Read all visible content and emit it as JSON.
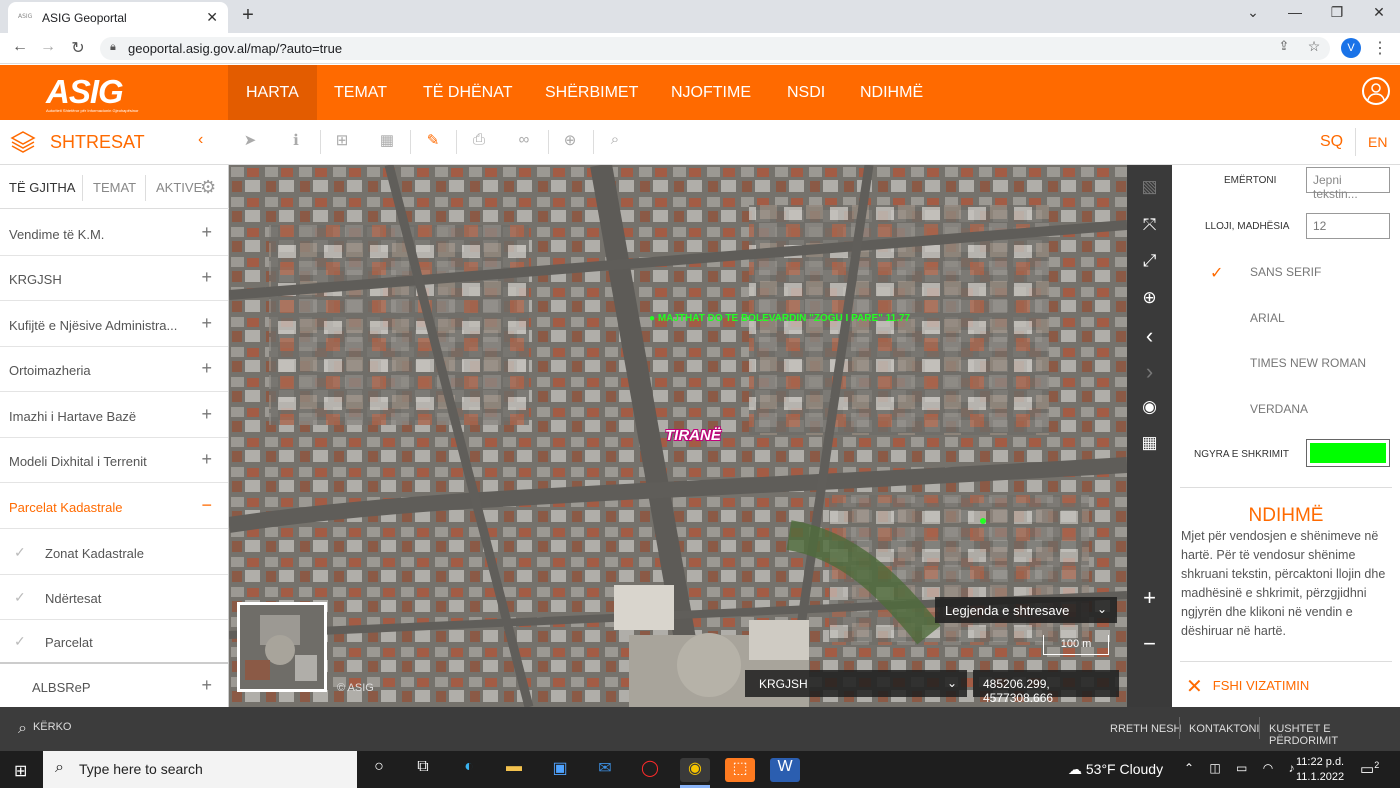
{
  "browser": {
    "tab_title": "ASIG Geoportal",
    "favicon_text": "ASIG",
    "url": "geoportal.asig.gov.al/map/?auto=true",
    "profile_initial": "V"
  },
  "header": {
    "logo_text": "ASIG",
    "logo_subtext": "Autoriteti Shtetëror për Informacionin Gjeohapësinor",
    "menu": [
      {
        "label": "HARTA"
      },
      {
        "label": "TEMAT"
      },
      {
        "label": "TË DHËNAT"
      },
      {
        "label": "SHËRBIMET"
      },
      {
        "label": "NJOFTIME"
      },
      {
        "label": "NSDI"
      },
      {
        "label": "NDIHMË"
      }
    ]
  },
  "toolbar": {
    "panel_title": "SHTRESAT",
    "lang_sq": "SQ",
    "lang_en": "EN"
  },
  "layers": {
    "tabs": [
      "TË GJITHA",
      "TEMAT",
      "AKTIVE"
    ],
    "items": [
      {
        "label": "Vendime të K.M.",
        "state": "+"
      },
      {
        "label": "KRGJSH",
        "state": "+"
      },
      {
        "label": "Kufijtë e Njësive Administra...",
        "state": "+"
      },
      {
        "label": "Ortoimazheria",
        "state": "+"
      },
      {
        "label": "Imazhi i Hartave Bazë",
        "state": "+"
      },
      {
        "label": "Modeli Dixhital i Terrenit",
        "state": "+"
      },
      {
        "label": "Parcelat Kadastrale",
        "state": "−"
      }
    ],
    "subitems": [
      {
        "label": "Zonat Kadastrale"
      },
      {
        "label": "Ndërtesat"
      },
      {
        "label": "Parcelat"
      }
    ],
    "last_item": {
      "label": "ALBSReP",
      "state": "+"
    }
  },
  "map": {
    "annotation": "● MAJTHAT DO TE BOLEVARDIN \"ZOGU I PARE\" 11.77",
    "city_label": "TIRANË",
    "copyright": "© ASIG",
    "legend_label": "Legjenda e shtresave",
    "scale_label": "100 m",
    "crs_value": "KRGJSH",
    "coordinates": "485206.299, 4577308.666"
  },
  "draw_panel": {
    "name_label": "EMËRTONI",
    "name_placeholder": "Jepni tekstin...",
    "size_label": "LLOJI, MADHËSIA",
    "size_value": "12",
    "fonts": [
      "SANS SERIF",
      "ARIAL",
      "TIMES NEW ROMAN",
      "VERDANA"
    ],
    "selected_font": "SANS SERIF",
    "color_label": "NGYRA E SHKRIMIT",
    "color_value": "#00ff00",
    "help_title": "NDIHMË",
    "help_text": "Mjet për vendosjen e shënimeve në hartë. Për të vendosur shënime shkruani tekstin, përcaktoni llojin dhe madhësinë e shkrimit, përzgjidhni ngjyrën dhe klikoni në vendin e dëshiruar në hartë.",
    "clear_label": "FSHI VIZATIMIN"
  },
  "footer": {
    "search_label": "KËRKO",
    "links": [
      "RRETH NESH",
      "KONTAKTONI",
      "KUSHTET E PËRDORIMIT"
    ]
  },
  "taskbar": {
    "search_placeholder": "Type here to search",
    "weather": "53°F  Cloudy",
    "time": "11:22 p.d.",
    "date": "11.1.2022",
    "notifications": "2"
  }
}
